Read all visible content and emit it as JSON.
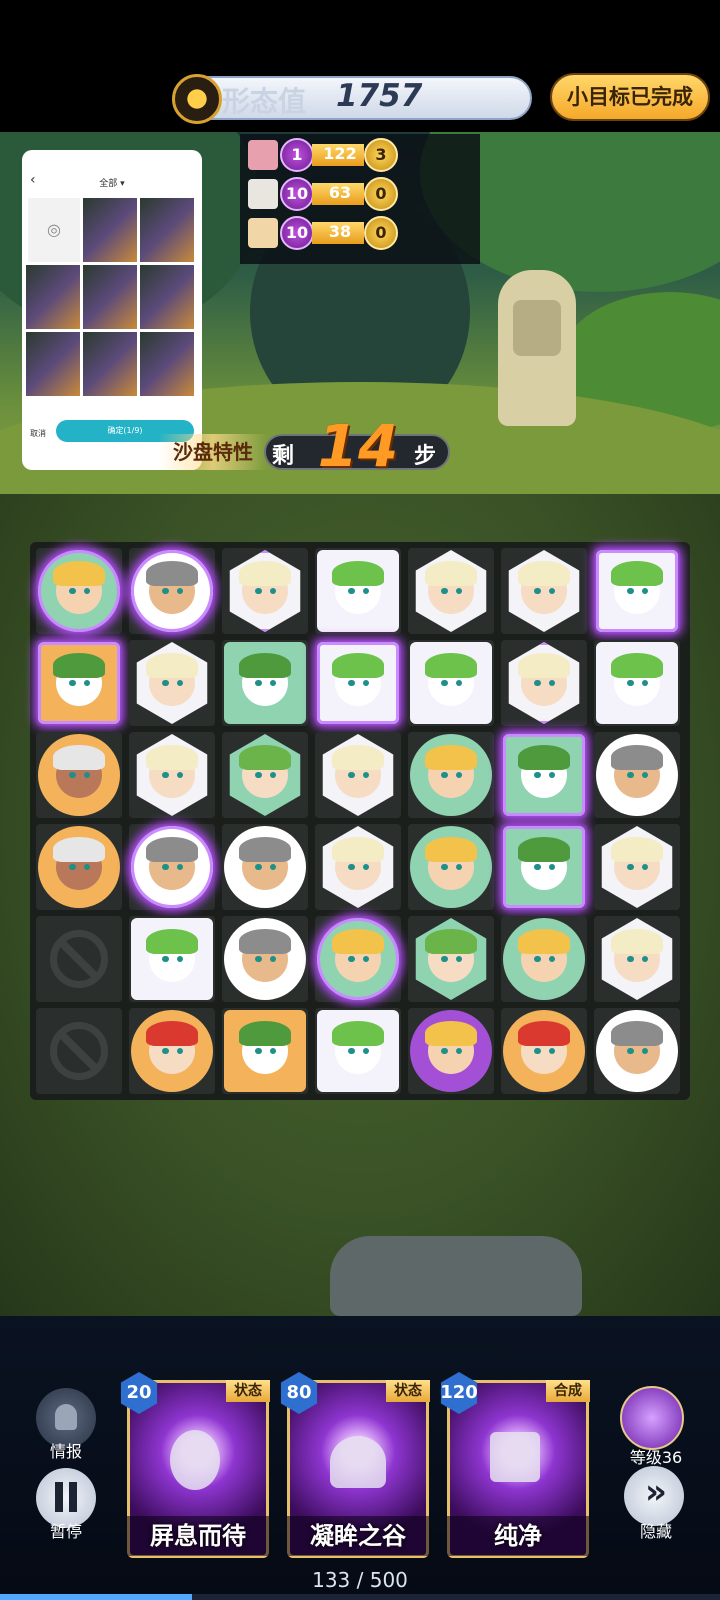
{
  "header": {
    "score_label": "形态值",
    "score_value": "1757",
    "goal_button": "小目标已完成"
  },
  "missions": [
    {
      "level": "1",
      "progress": "122",
      "reward": "3",
      "avatar_color": "#e7a1ae"
    },
    {
      "level": "10",
      "progress": "63",
      "reward": "0",
      "avatar_color": "#e9e6e0"
    },
    {
      "level": "10",
      "progress": "38",
      "reward": "0",
      "avatar_color": "#f1d7a7"
    }
  ],
  "gallery": {
    "back": "‹",
    "title": "全部 ▾",
    "cancel": "取消",
    "confirm": "确定(1/9)"
  },
  "moves": {
    "trait": "沙盘特性",
    "prefix": "剩",
    "number": "14",
    "suffix": "步"
  },
  "board": {
    "rows": [
      [
        "blonde-girl",
        "headband-boy",
        "white-hair-girl",
        "white-dog",
        "white-hair-girl",
        "white-hair-girl",
        "white-dog"
      ],
      [
        "green-dog-gold",
        "white-hair-girl",
        "green-dog",
        "white-dog",
        "white-dog",
        "white-hair-girl",
        "white-dog"
      ],
      [
        "wolf-hood-girl",
        "white-hair-girl",
        "green-hair-girl",
        "white-hair-girl",
        "blonde-girl",
        "green-dog",
        "headband-boy"
      ],
      [
        "wolf-hood-girl",
        "headband-boy",
        "headband-boy",
        "white-hair-girl",
        "blonde-girl",
        "green-dog",
        "white-hair-girl"
      ],
      [
        "blocked",
        "white-dog",
        "headband-boy",
        "blonde-girl",
        "green-hair-girl",
        "blonde-girl",
        "white-hair-girl"
      ],
      [
        "blocked",
        "red-hair-boy",
        "green-dog-gold",
        "white-dog",
        "purple-crown-girl",
        "red-hair-boy",
        "headband-boy"
      ]
    ],
    "glowing": [
      "0-0",
      "0-1",
      "0-2",
      "0-6",
      "1-0",
      "1-3",
      "1-5",
      "2-5",
      "3-1",
      "3-5",
      "4-3"
    ]
  },
  "bottom": {
    "intel_label": "情报",
    "pause_label": "暂停",
    "level_label": "等级36",
    "hide_label": "隐藏",
    "progress_text": "133 / 500",
    "progress_fraction": 0.266
  },
  "cards": [
    {
      "cost": "20",
      "tag": "状态",
      "name": "屏息而待",
      "icon": "gourd-icon"
    },
    {
      "cost": "80",
      "tag": "状态",
      "name": "凝眸之谷",
      "icon": "lock-icon"
    },
    {
      "cost": "120",
      "tag": "合成",
      "name": "纯净",
      "icon": "square-gem-icon"
    }
  ],
  "colors": {
    "accent_gold": "#f5a92a",
    "glow_purple": "#b84dff",
    "moves_orange": "#ff9a24"
  }
}
